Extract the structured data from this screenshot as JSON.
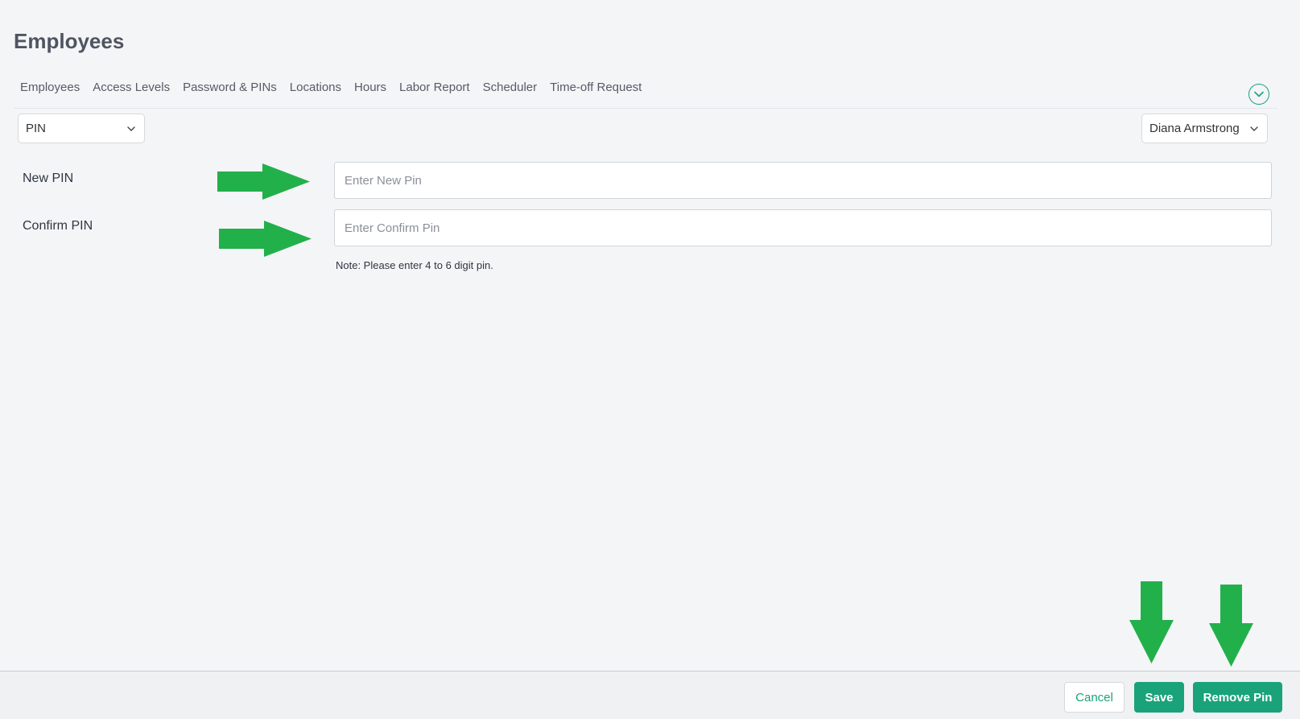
{
  "header": {
    "title": "Employees"
  },
  "tabs": [
    {
      "label": "Employees"
    },
    {
      "label": "Access Levels"
    },
    {
      "label": "Password & PINs"
    },
    {
      "label": "Locations"
    },
    {
      "label": "Hours"
    },
    {
      "label": "Labor Report"
    },
    {
      "label": "Scheduler"
    },
    {
      "label": "Time-off Request"
    }
  ],
  "type_select": {
    "value": "PIN"
  },
  "employee_select": {
    "value": "Diana Armstrong"
  },
  "form": {
    "new_pin": {
      "label": "New PIN",
      "placeholder": "Enter New Pin",
      "value": ""
    },
    "confirm_pin": {
      "label": "Confirm PIN",
      "placeholder": "Enter Confirm Pin",
      "value": ""
    },
    "note": "Note: Please enter 4 to 6 digit pin."
  },
  "footer": {
    "cancel_label": "Cancel",
    "save_label": "Save",
    "remove_label": "Remove Pin"
  },
  "colors": {
    "accent": "#1aa37a",
    "annotation_arrow": "#22b04b",
    "background": "#f4f5f7"
  },
  "icons": {
    "collapse": "chevron-down-circle-icon",
    "select_chevron": "chevron-down-icon",
    "annotation": "arrow-icon"
  }
}
